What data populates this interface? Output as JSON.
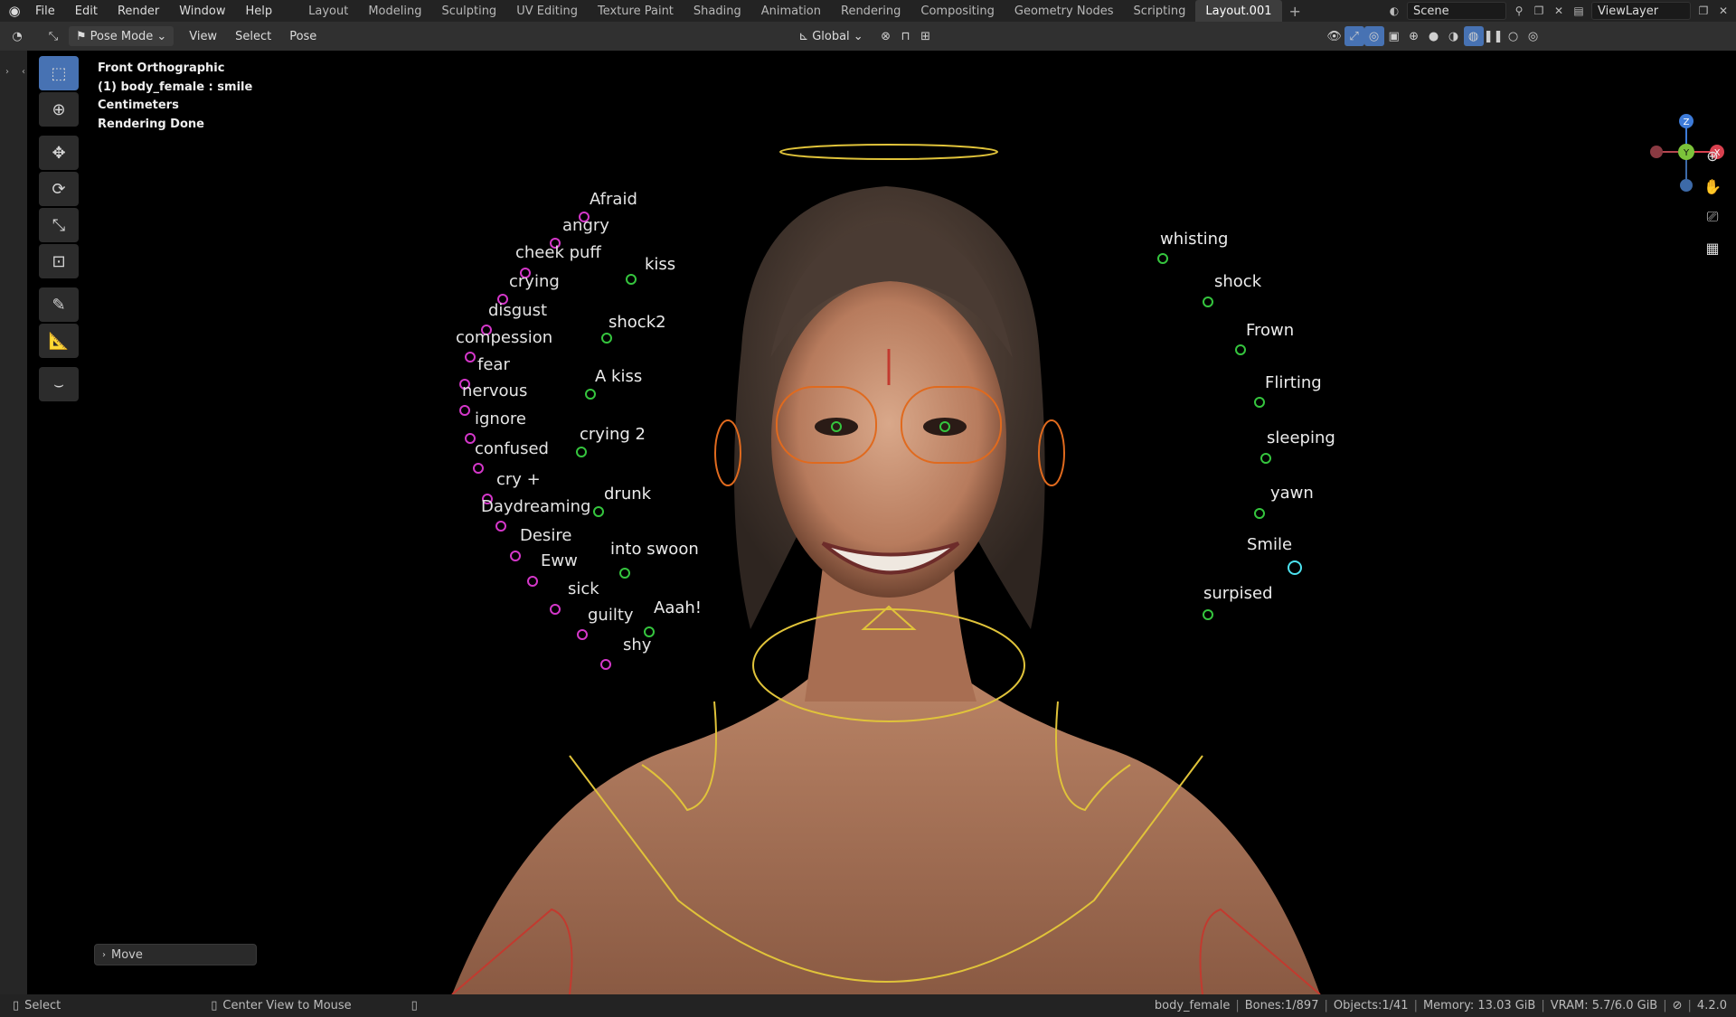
{
  "menu": {
    "items": [
      "File",
      "Edit",
      "Render",
      "Window",
      "Help"
    ]
  },
  "workspaces": {
    "tabs": [
      "Layout",
      "Modeling",
      "Sculpting",
      "UV Editing",
      "Texture Paint",
      "Shading",
      "Animation",
      "Rendering",
      "Compositing",
      "Geometry Nodes",
      "Scripting",
      "Layout.001"
    ],
    "active": "Layout.001",
    "add_label": "+"
  },
  "scene": {
    "name": "Scene",
    "view_layer": "ViewLayer"
  },
  "header": {
    "mode": "Pose Mode",
    "menus": [
      "View",
      "Select",
      "Pose"
    ],
    "orientation": "Global"
  },
  "overlay": {
    "view": "Front Orthographic",
    "object": "(1) body_female : smile",
    "units": "Centimeters",
    "status": "Rendering Done"
  },
  "gizmo": {
    "z": "Z",
    "y": "Y",
    "x": "X"
  },
  "left_labels": [
    "Afraid",
    "angry",
    "cheek puff",
    "crying",
    "disgust",
    "compession",
    "fear",
    "nervous",
    "ignore",
    "confused",
    "cry +",
    "Daydreaming",
    "Desire",
    "Eww",
    "sick",
    "guilty",
    "shy"
  ],
  "mid_labels": [
    "kiss",
    "shock2",
    "A kiss",
    "crying 2",
    "drunk",
    "into swoon",
    "Aaah!"
  ],
  "right_labels": [
    "whisting",
    "shock",
    "Frown",
    "Flirting",
    "sleeping",
    "yawn",
    "Smile",
    "surpised"
  ],
  "move_panel": "Move",
  "status": {
    "select": "Select",
    "center": "Center View to Mouse",
    "object": "body_female",
    "bones": "Bones:1/897",
    "objects": "Objects:1/41",
    "memory": "Memory: 13.03 GiB",
    "vram": "VRAM: 5.7/6.0 GiB",
    "version": "4.2.0"
  },
  "colors": {
    "active_tool": "#4772b3",
    "left_ctrl": "#d437c9",
    "right_ctrl": "#35c53e",
    "selected_ctrl": "#4de3f0",
    "rig_yellow": "#e0c33a",
    "rig_orange": "#e06a1e"
  }
}
